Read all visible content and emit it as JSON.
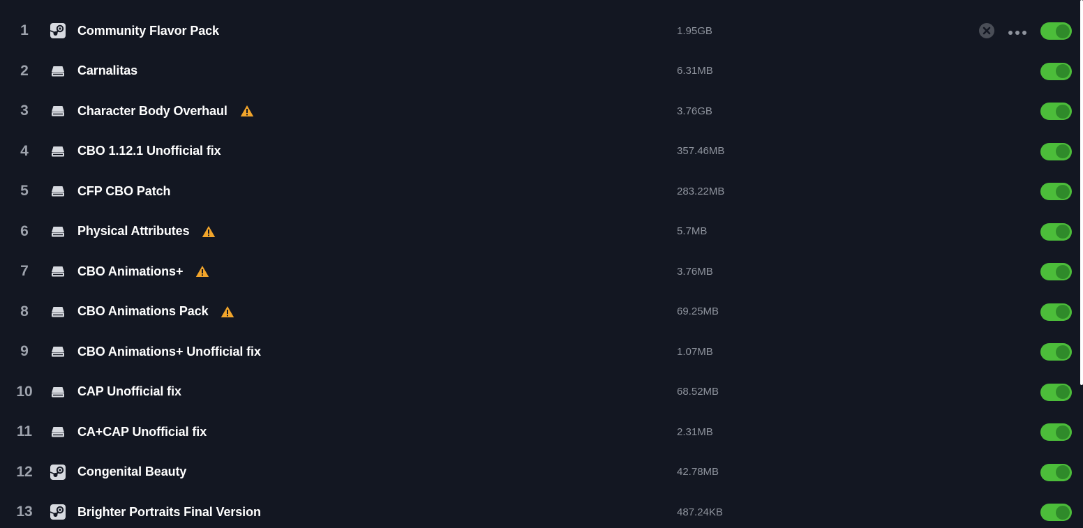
{
  "mods": [
    {
      "index": "1",
      "source": "steam",
      "name": "Community Flavor Pack",
      "size": "1.95GB",
      "warning": false,
      "enabled": true
    },
    {
      "index": "2",
      "source": "local",
      "name": "Carnalitas",
      "size": "6.31MB",
      "warning": false,
      "enabled": true
    },
    {
      "index": "3",
      "source": "local",
      "name": "Character Body Overhaul",
      "size": "3.76GB",
      "warning": true,
      "enabled": true
    },
    {
      "index": "4",
      "source": "local",
      "name": "CBO 1.12.1 Unofficial fix",
      "size": "357.46MB",
      "warning": false,
      "enabled": true
    },
    {
      "index": "5",
      "source": "local",
      "name": "CFP CBO Patch",
      "size": "283.22MB",
      "warning": false,
      "enabled": true
    },
    {
      "index": "6",
      "source": "local",
      "name": "Physical Attributes",
      "size": "5.7MB",
      "warning": true,
      "enabled": true
    },
    {
      "index": "7",
      "source": "local",
      "name": "CBO Animations+",
      "size": "3.76MB",
      "warning": true,
      "enabled": true
    },
    {
      "index": "8",
      "source": "local",
      "name": "CBO Animations Pack",
      "size": "69.25MB",
      "warning": true,
      "enabled": true
    },
    {
      "index": "9",
      "source": "local",
      "name": "CBO Animations+ Unofficial fix",
      "size": "1.07MB",
      "warning": false,
      "enabled": true
    },
    {
      "index": "10",
      "source": "local",
      "name": "CAP Unofficial fix",
      "size": "68.52MB",
      "warning": false,
      "enabled": true
    },
    {
      "index": "11",
      "source": "local",
      "name": "CA+CAP Unofficial fix",
      "size": "2.31MB",
      "warning": false,
      "enabled": true
    },
    {
      "index": "12",
      "source": "steam",
      "name": "Congenital Beauty",
      "size": "42.78MB",
      "warning": false,
      "enabled": true
    },
    {
      "index": "13",
      "source": "steam",
      "name": "Brighter Portraits Final Version",
      "size": "487.24KB",
      "warning": false,
      "enabled": true
    }
  ],
  "hovered_row_actions": {
    "row": "1",
    "icons": [
      "remove-icon",
      "more-options-icon"
    ]
  },
  "colors": {
    "background": "#131722",
    "toggle_on": "#4cbd3a",
    "toggle_knob": "#2f8a2a",
    "warning": "#f2a52b",
    "index_text": "#9ea3ad",
    "size_text": "#8f949e"
  }
}
